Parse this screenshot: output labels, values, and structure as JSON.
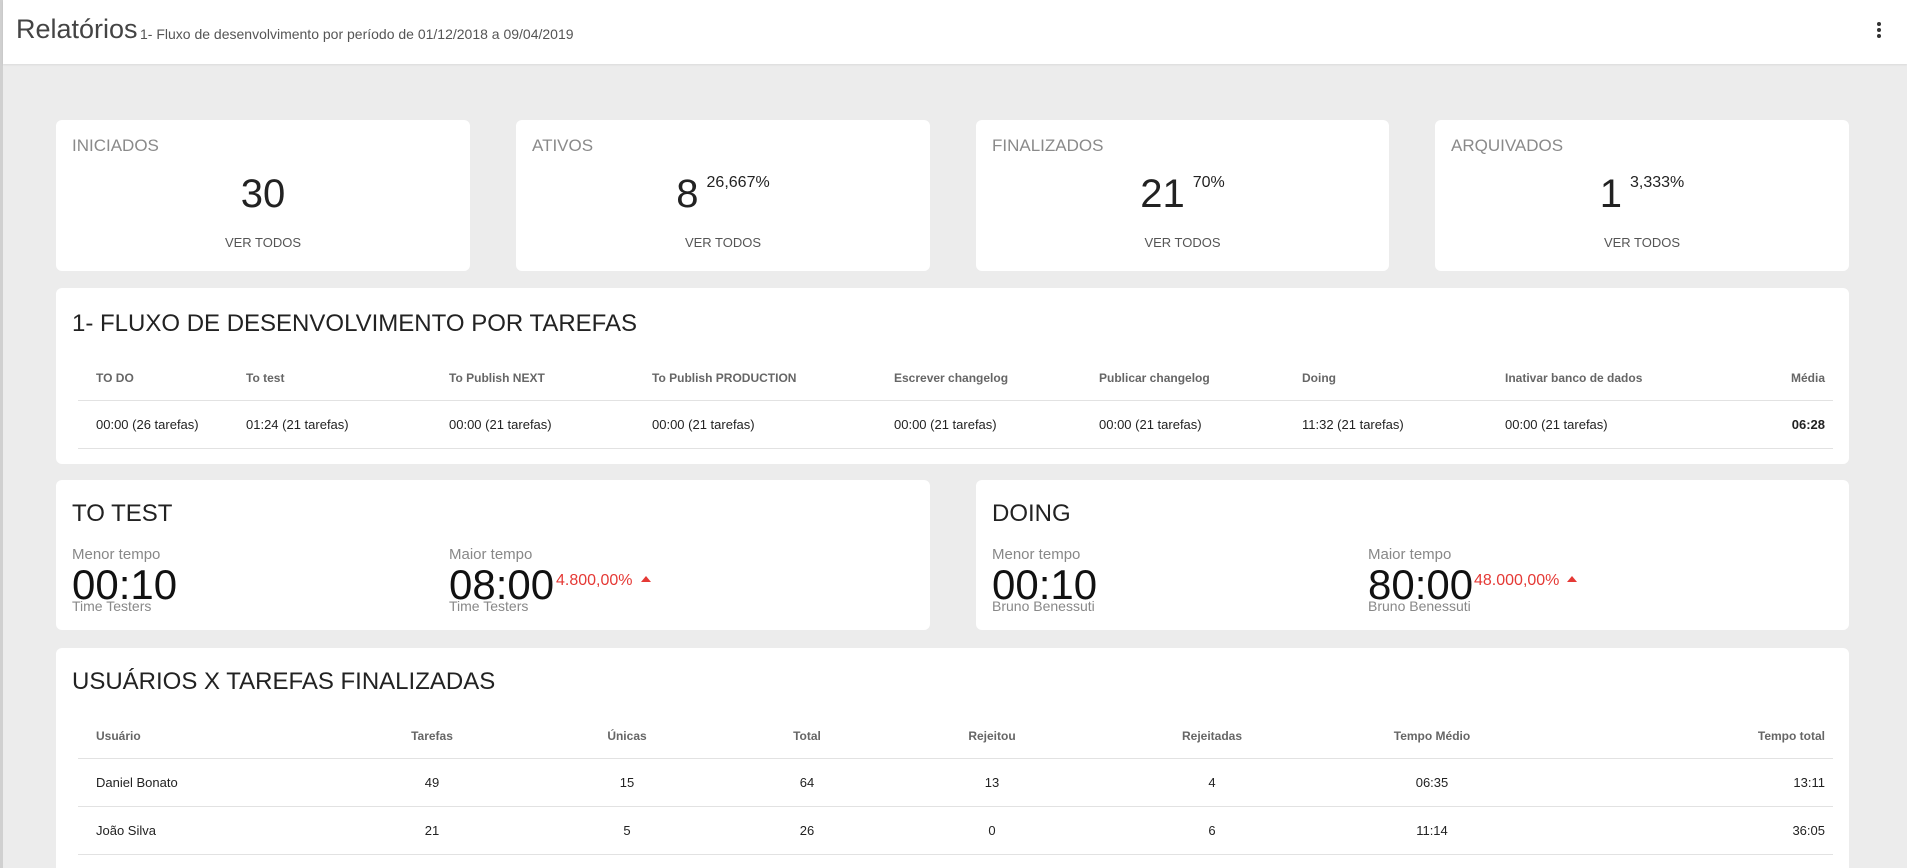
{
  "header": {
    "title": "Relatórios",
    "subtitle": "1- Fluxo de desenvolvimento por período de 01/12/2018 a 09/04/2019"
  },
  "stats": [
    {
      "label": "INICIADOS",
      "value": "30",
      "percent": "",
      "link": "VER TODOS"
    },
    {
      "label": "ATIVOS",
      "value": "8",
      "percent": "26,667%",
      "link": "VER TODOS"
    },
    {
      "label": "FINALIZADOS",
      "value": "21",
      "percent": "70%",
      "link": "VER TODOS"
    },
    {
      "label": "ARQUIVADOS",
      "value": "1",
      "percent": "3,333%",
      "link": "VER TODOS"
    }
  ],
  "flow": {
    "title": "1- FLUXO DE DESENVOLVIMENTO POR TAREFAS",
    "columns": [
      "TO DO",
      "To test",
      "To Publish NEXT",
      "To Publish PRODUCTION",
      "Escrever changelog",
      "Publicar changelog",
      "Doing",
      "Inativar banco de dados",
      "Média"
    ],
    "row": [
      "00:00 (26 tarefas)",
      "01:24 (21 tarefas)",
      "00:00 (21 tarefas)",
      "00:00 (21 tarefas)",
      "00:00 (21 tarefas)",
      "00:00 (21 tarefas)",
      "11:32 (21 tarefas)",
      "00:00 (21 tarefas)",
      "06:28"
    ]
  },
  "to_test": {
    "title": "TO TEST",
    "min_label": "Menor tempo",
    "min_value": "00:10",
    "min_person": "Time Testers",
    "max_label": "Maior tempo",
    "max_value": "08:00",
    "max_delta": "4.800,00%",
    "max_person": "Time Testers"
  },
  "doing": {
    "title": "DOING",
    "min_label": "Menor tempo",
    "min_value": "00:10",
    "min_person": "Bruno Benessuti",
    "max_label": "Maior tempo",
    "max_value": "80:00",
    "max_delta": "48.000,00%",
    "max_person": "Bruno Benessuti"
  },
  "users": {
    "title": "USUÁRIOS X TAREFAS FINALIZADAS",
    "columns": [
      "Usuário",
      "Tarefas",
      "Únicas",
      "Total",
      "Rejeitou",
      "Rejeitadas",
      "Tempo Médio",
      "Tempo total"
    ],
    "rows": [
      [
        "Daniel Bonato",
        "49",
        "15",
        "64",
        "13",
        "4",
        "06:35",
        "13:11"
      ],
      [
        "João Silva",
        "21",
        "5",
        "26",
        "0",
        "6",
        "11:14",
        "36:05"
      ]
    ]
  },
  "colors": {
    "accent_red": "#e53935",
    "background": "#ececec"
  }
}
